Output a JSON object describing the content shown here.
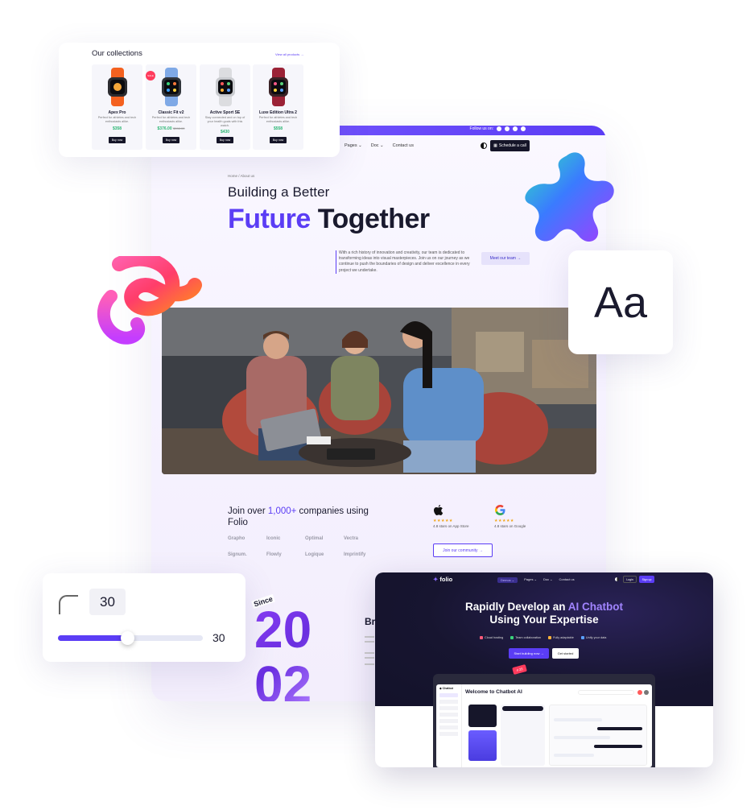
{
  "collections": {
    "title": "Our collections",
    "view_all": "View all products →",
    "products": [
      {
        "name": "Apex Pro",
        "desc": "Perfect for athletes and tech enthusiasts alike.",
        "price": "$358",
        "old_price": "",
        "cta": "Buy now",
        "band": "#f4611f",
        "sale": ""
      },
      {
        "name": "Classic Fit v2",
        "desc": "Perfect for athletes and tech enthusiasts alike.",
        "price": "$376.00",
        "old_price": "$398.00",
        "cta": "Buy now",
        "band": "#7fa9e6",
        "sale": "SALE"
      },
      {
        "name": "Active Sport SE",
        "desc": "Stay connected and on top of your health goals with this watch.",
        "price": "$430",
        "old_price": "",
        "cta": "Buy now",
        "band": "#d9dadd",
        "sale": ""
      },
      {
        "name": "Luxe Edition Ultra 2",
        "desc": "Perfect for athletes and tech enthusiasts alike.",
        "price": "$558",
        "old_price": "",
        "cta": "Buy now",
        "band": "#9b2236",
        "sale": ""
      }
    ]
  },
  "site": {
    "follow": "Follow us on:",
    "nav": [
      "Pages ⌄",
      "Doc ⌄",
      "Contact us"
    ],
    "schedule_label": "Schedule a call",
    "breadcrumb": "Home  /  About us",
    "headline_1": "Building a Better",
    "headline_accent": "Future",
    "headline_rest": " Together",
    "intro": "With a rich history of innovation and creativity, our team is dedicated to transforming ideas into visual masterpieces. Join us on our journey as we continue to push the boundaries of design and deliver excellence in every project we undertake.",
    "meet_label": "Meet our team →",
    "join_pre": "Join over ",
    "join_accent": "1,000+",
    "join_post": " companies using Folio",
    "logos": [
      "Grapho",
      "Iconic",
      "Optimal",
      "Vectra",
      "Signum.",
      "Flowly",
      "Logique",
      "Imprintify"
    ],
    "ratings": [
      {
        "stars": "★★★★★",
        "label": "4.8 stars on App Store"
      },
      {
        "stars": "★★★★★",
        "label": "4.8 stars on Google"
      }
    ],
    "community_label": "Join our community →",
    "since": "Since",
    "year_top": "20",
    "year_bottom": "02",
    "br_heading": "Br",
    "accent": "#5b3df5"
  },
  "font_card": {
    "sample": "Aa"
  },
  "radius": {
    "value": "30",
    "readout": "30",
    "fraction": 0.48
  },
  "chatbot": {
    "logo": "folio",
    "nav": [
      "Demos ⌄",
      "Pages ⌄",
      "Doc ⌄",
      "Contact us"
    ],
    "login": "Login",
    "signup": "Sign up",
    "title_1": "Rapidly Develop an ",
    "title_accent": "AI Chatbot",
    "title_2": "Using Your Expertise",
    "features": [
      "Cloud hosting",
      "Team collaboration",
      "Fully adaptable",
      "Unify your data"
    ],
    "cta_primary": "Start building now →",
    "cta_secondary": "Get started",
    "app_title": "Welcome to Chatbot AI",
    "app_logo": "Chatbot",
    "badge": "# 23"
  }
}
